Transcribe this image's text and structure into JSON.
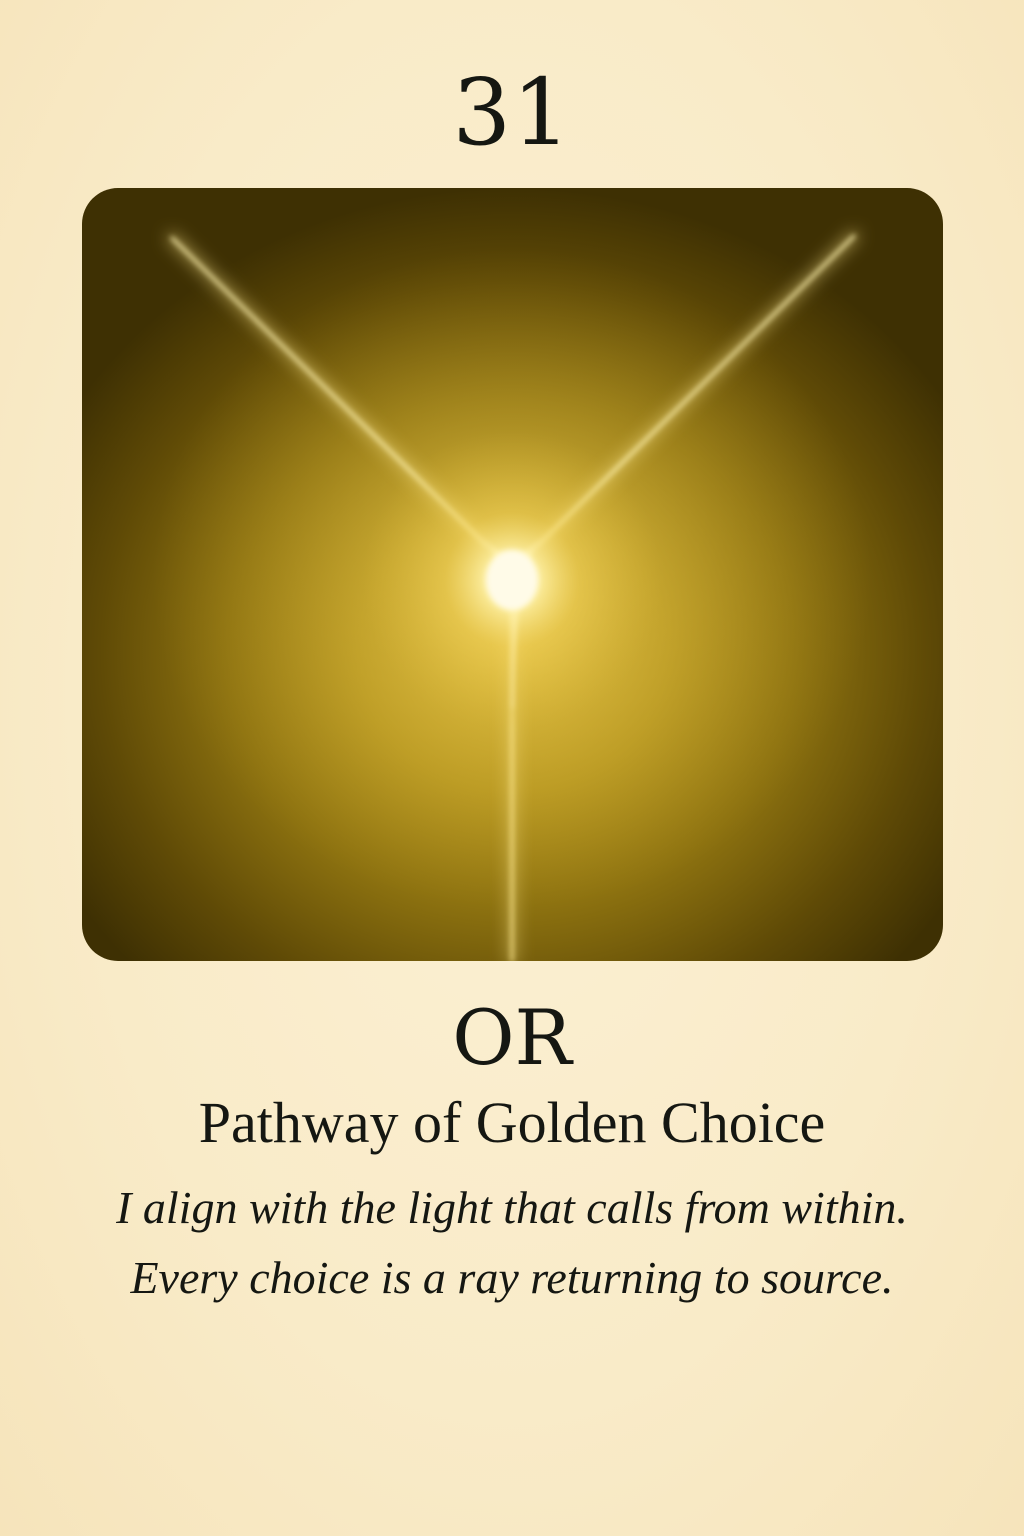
{
  "card": {
    "number": "31",
    "name": "OR",
    "subtitle": "Pathway of Golden Choice",
    "affirmation_lines": [
      "I align with the light that calls from within.",
      "Every choice is a ray returning to source."
    ]
  },
  "artwork": {
    "motif": "glowing-y-light-icon"
  },
  "colors": {
    "background": "#f9ebc8",
    "text": "#151712",
    "art_dark": "#3e3003",
    "art_gold": "#b6961f",
    "light": "#fff6c8"
  }
}
